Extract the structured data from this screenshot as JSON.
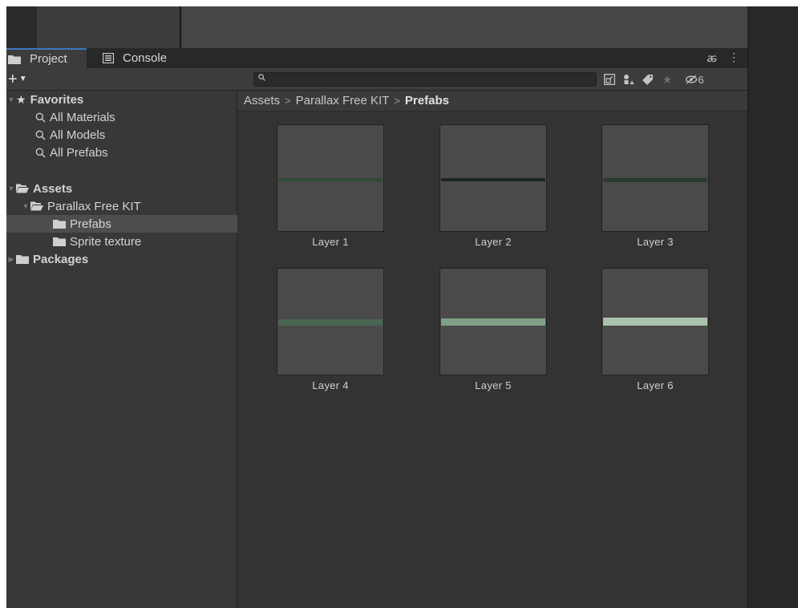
{
  "tabs": [
    {
      "label": "Project",
      "active": true,
      "icon": "folder-icon"
    },
    {
      "label": "Console",
      "active": false,
      "icon": "console-icon"
    }
  ],
  "tab_actions": {
    "lock": "ꬱ",
    "menu": "⋮"
  },
  "toolbar": {
    "create_label": "+",
    "search_placeholder": "",
    "search_value": "",
    "hidden_count": "6"
  },
  "tree": {
    "favorites": {
      "label": "Favorites",
      "items": [
        {
          "label": "All Materials"
        },
        {
          "label": "All Models"
        },
        {
          "label": "All Prefabs"
        }
      ]
    },
    "assets": {
      "label": "Assets",
      "children": [
        {
          "label": "Parallax Free KIT",
          "children": [
            {
              "label": "Prefabs",
              "selected": true
            },
            {
              "label": "Sprite texture",
              "selected": false
            }
          ]
        }
      ]
    },
    "packages": {
      "label": "Packages"
    }
  },
  "breadcrumb": [
    "Assets",
    "Parallax Free KIT",
    "Prefabs"
  ],
  "assets_grid": [
    {
      "label": "Layer 1",
      "strip_color": "#2f4a36"
    },
    {
      "label": "Layer 2",
      "strip_color": "#1d2620"
    },
    {
      "label": "Layer 3",
      "strip_color": "#2a3a2f"
    },
    {
      "label": "Layer 4",
      "strip_color": "#4a6452"
    },
    {
      "label": "Layer 5",
      "strip_color": "#7fa085"
    },
    {
      "label": "Layer 6",
      "strip_color": "#a9c3ad"
    }
  ],
  "colors": {
    "accent_tab": "#3a79bb",
    "selected_row": "#4d4d4d",
    "panel_bg": "#383838",
    "content_bg": "#333333"
  }
}
